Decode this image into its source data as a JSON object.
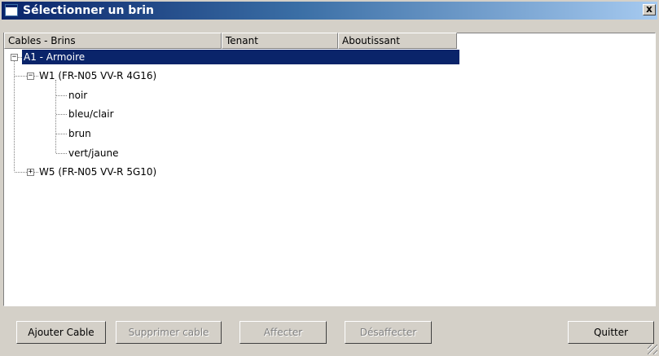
{
  "window": {
    "title": "Sélectionner un brin",
    "close_label": "x"
  },
  "columns": [
    "Cables - Brins",
    "Tenant",
    "Aboutissant"
  ],
  "tree": {
    "root": {
      "label": "A1 - Armoire",
      "expanded": true,
      "selected": true
    },
    "cables": [
      {
        "label": "W1 (FR-N05 VV-R 4G16)",
        "expanded": true,
        "strands": [
          "noir",
          "bleu/clair",
          "brun",
          "vert/jaune"
        ]
      },
      {
        "label": "W5 (FR-N05 VV-R 5G10)",
        "expanded": false,
        "strands": []
      }
    ]
  },
  "buttons": {
    "add_cable": "Ajouter Cable",
    "delete_cable": "Supprimer cable",
    "assign": "Affecter",
    "unassign": "Désaffecter",
    "quit": "Quitter"
  },
  "colors": {
    "selection": "#0a246a",
    "title_gradient_start": "#0a246a",
    "title_gradient_end": "#a6caf0",
    "face": "#d4d0c8"
  }
}
